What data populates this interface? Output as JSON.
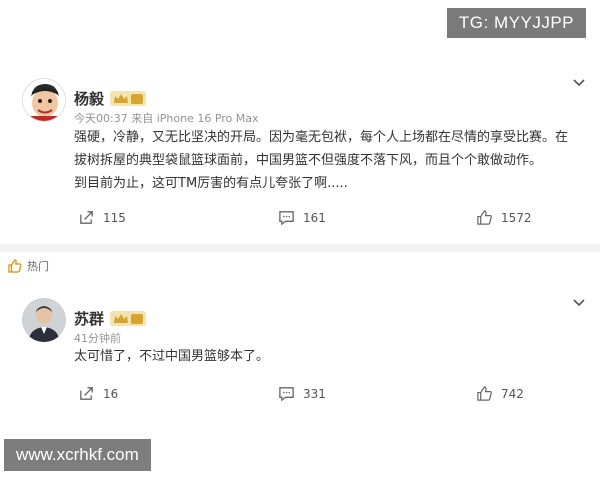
{
  "watermarks": {
    "top": "TG: MYYJJPP",
    "bottom": "www.xcrhkf.com"
  },
  "hot_label": "热门",
  "posts": [
    {
      "name": "杨毅",
      "meta": "今天00:37  来自 iPhone 16 Pro Max",
      "lines": [
        "强硬，冷静，又无比坚决的开局。因为毫无包袱，每个人上场都在尽情的享受比赛。在",
        "拔树拆屋的典型袋鼠篮球面前，中国男篮不但强度不落下风，而且个个敢做动作。",
        "到目前为止，这可TM厉害的有点儿夸张了啊....."
      ],
      "share": "115",
      "comments": "161",
      "likes": "1572"
    },
    {
      "name": "苏群",
      "meta": "41分钟前",
      "lines": [
        "太可惜了，不过中国男篮够本了。"
      ],
      "share": "16",
      "comments": "331",
      "likes": "742"
    }
  ],
  "colors": {
    "vip_gold": "#d6a42f",
    "vip_bg": "#f3e3b0",
    "meta_gray": "#939393"
  }
}
